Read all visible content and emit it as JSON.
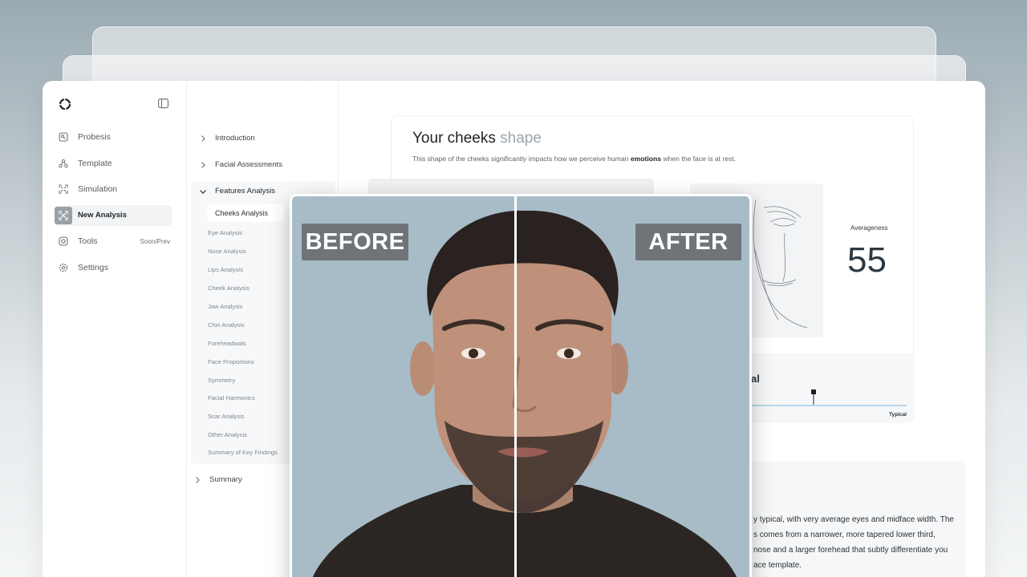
{
  "sidebar": {
    "items": [
      {
        "label": "Probesis",
        "icon": "report-icon"
      },
      {
        "label": "Template",
        "icon": "nodes-icon"
      },
      {
        "label": "Simulation",
        "icon": "expand-icon"
      },
      {
        "label": "New Analysis",
        "icon": "scan-icon",
        "active": true
      },
      {
        "label": "Tools",
        "icon": "camera-icon",
        "badge": "Soon/Prev"
      },
      {
        "label": "Settings",
        "icon": "gear-icon"
      }
    ]
  },
  "tree": {
    "introduction": "Introduction",
    "facial_assessments": "Facial Assessments",
    "features_analysis": "Features Analysis",
    "active_sub": "Cheeks Analysis",
    "sub_items": [
      "Eye Analysis",
      "Nose Analysis",
      "Lips Analysis",
      "Cheek Analysis",
      "Jaw Analysis",
      "Chin Analysis",
      "Foreheadwals",
      "Face Proportions",
      "Symmetry",
      "Facial Harmonics",
      "Scar Analysis",
      "Other Analysis",
      "Summary of Key Findings"
    ],
    "summary": "Summary"
  },
  "card": {
    "title_main": "Your cheeks",
    "title_accent": "shape",
    "subtitle_pre": "This shape of the cheeks significantly impacts how we perceive human",
    "subtitle_bold": "emotions",
    "subtitle_post": "when the face is at rest.",
    "averageness_label": "Averageness",
    "averageness_value": "55",
    "scale_heading": "al",
    "scale_tick": "Typical",
    "scale_position": 0.42
  },
  "text_card": {
    "lines": [
      "y typical, with very average eyes and midface width. The",
      "s comes from a narrower, more tapered lower third,",
      "nose and a larger forehead that subtly differentiate you",
      "ace template."
    ]
  },
  "compare": {
    "before_label": "BEFORE",
    "after_label": "AFTER",
    "background_color": "#a7bcc7"
  }
}
